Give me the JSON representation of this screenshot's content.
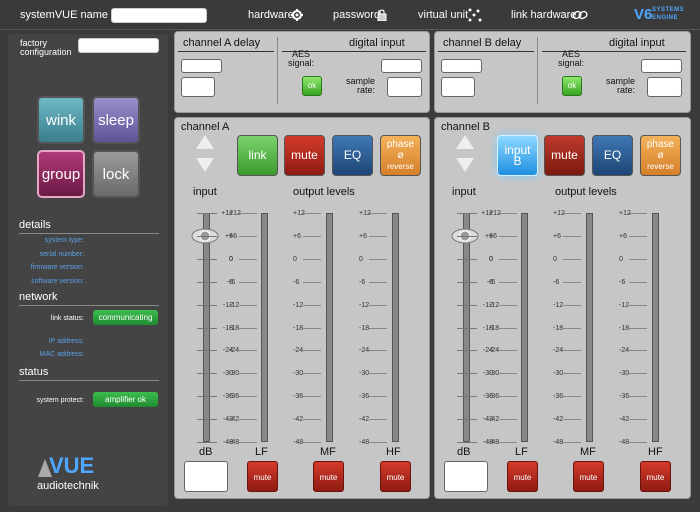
{
  "topbar": {
    "name_label": "systemVUE name",
    "hardware": "hardware",
    "password": "password",
    "virtual_unit": "virtual unit",
    "link_hardware": "link hardware",
    "logo_main": "V6",
    "logo_sub1": "SYSTEMS",
    "logo_sub2": "ENGINE"
  },
  "sidebar": {
    "factory_label_1": "factory",
    "factory_label_2": "configuration",
    "buttons": {
      "wink": "wink",
      "sleep": "sleep",
      "group": "group",
      "lock": "lock"
    },
    "details_title": "details",
    "details": [
      "system type:",
      "serial number:",
      "firmware version:",
      "software version:"
    ],
    "network_title": "network",
    "link_status_label": "link status:",
    "link_status_value": "communicating",
    "ip_label": "IP address:",
    "mac_label": "MAC address:",
    "status_title": "status",
    "protect_label": "system protect:",
    "protect_value": "amplifier ok",
    "brand_main": "VUE",
    "brand_sub": "audiotechnik"
  },
  "chA": {
    "delay_title": "channel A delay",
    "digital_title": "digital input",
    "aes_label_1": "AES",
    "aes_label_2": "signal:",
    "ok": "ok",
    "sr_label_1": "sample",
    "sr_label_2": "rate:",
    "title": "channel A",
    "link": "link",
    "mute": "mute",
    "eq": "EQ",
    "phase_1": "phase",
    "phase_2": "ø",
    "phase_3": "reverse",
    "input": "input",
    "output_levels": "output levels",
    "db": "dB",
    "lf": "LF",
    "mf": "MF",
    "hf": "HF",
    "mute_sm": "mute"
  },
  "chB": {
    "delay_title": "channel B delay",
    "digital_title": "digital input",
    "aes_label_1": "AES",
    "aes_label_2": "signal:",
    "ok": "ok",
    "sr_label_1": "sample",
    "sr_label_2": "rate:",
    "title": "channel B",
    "input_b_1": "input",
    "input_b_2": "B",
    "mute": "mute",
    "eq": "EQ",
    "phase_1": "phase",
    "phase_2": "ø",
    "phase_3": "reverse",
    "input": "input",
    "output_levels": "output levels",
    "db": "dB",
    "lf": "LF",
    "mf": "MF",
    "hf": "HF",
    "mute_sm": "mute"
  },
  "scale": [
    "+12",
    "+6",
    "0",
    "-6",
    "-12",
    "-18",
    "-24",
    "-30",
    "-36",
    "-42",
    "-48"
  ],
  "colors": {
    "accent_blue": "#4ea6ff",
    "green": "#3cbd4e",
    "red": "#c42f22",
    "eq_blue": "#2b5a8f",
    "orange": "#f0a040"
  }
}
